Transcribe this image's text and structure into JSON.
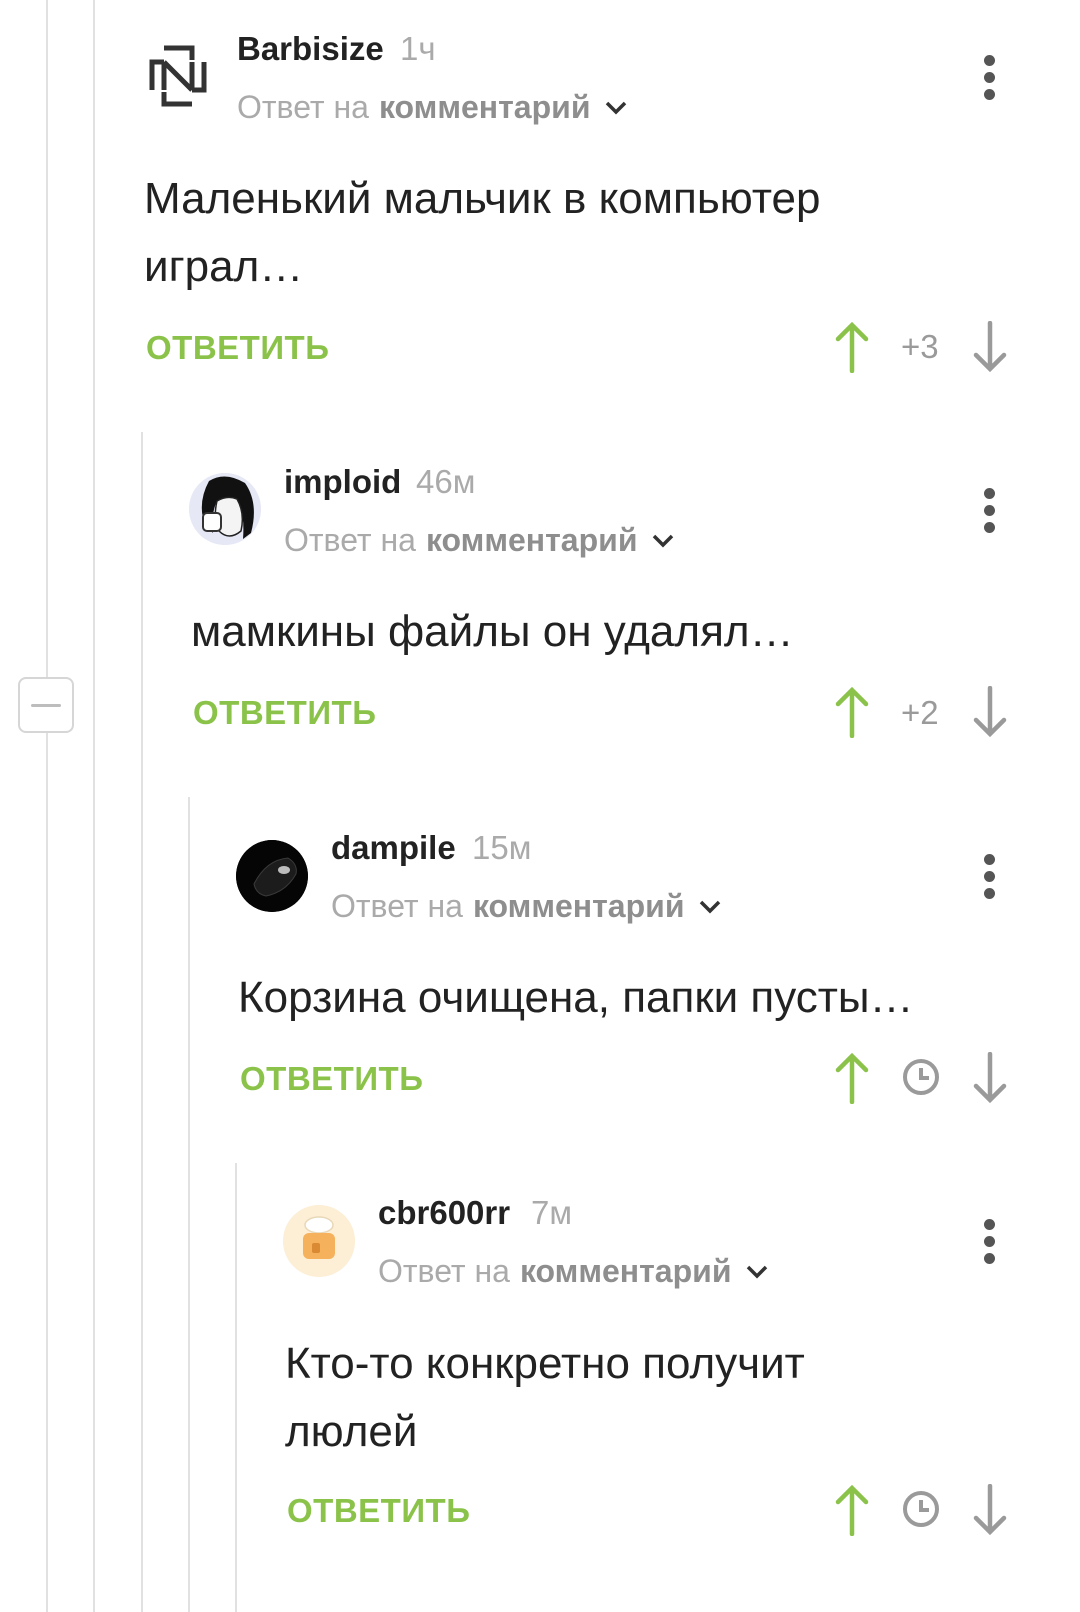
{
  "thread": {
    "reply_label": "ОТВЕТИТЬ",
    "reply_to_prefix": "Ответ на",
    "reply_to_target": "комментарий"
  },
  "comments": [
    {
      "author": "Barbisize",
      "time": "1ч",
      "text": "Маленький мальчик в компьютер играл…",
      "score": "+3",
      "avatar_icon": "rammstein-logo-icon"
    },
    {
      "author": "imploid",
      "time": "46м",
      "text": "мамкины файлы он удалял…",
      "score": "+2",
      "avatar_icon": "anime-avatar"
    },
    {
      "author": "dampile",
      "time": "15м",
      "text": "Корзина очищена, папки пусты…",
      "score": "",
      "score_icon": "clock-icon",
      "avatar_icon": "dark-avatar"
    },
    {
      "author": "cbr600rr",
      "time": "7м",
      "text": "Кто-то конкретно получит люлей",
      "score": "",
      "score_icon": "clock-icon",
      "avatar_icon": "cake-avatar"
    }
  ],
  "colors": {
    "accent_green": "#8bc34a",
    "muted": "#aaaaaa",
    "text": "#222222"
  }
}
